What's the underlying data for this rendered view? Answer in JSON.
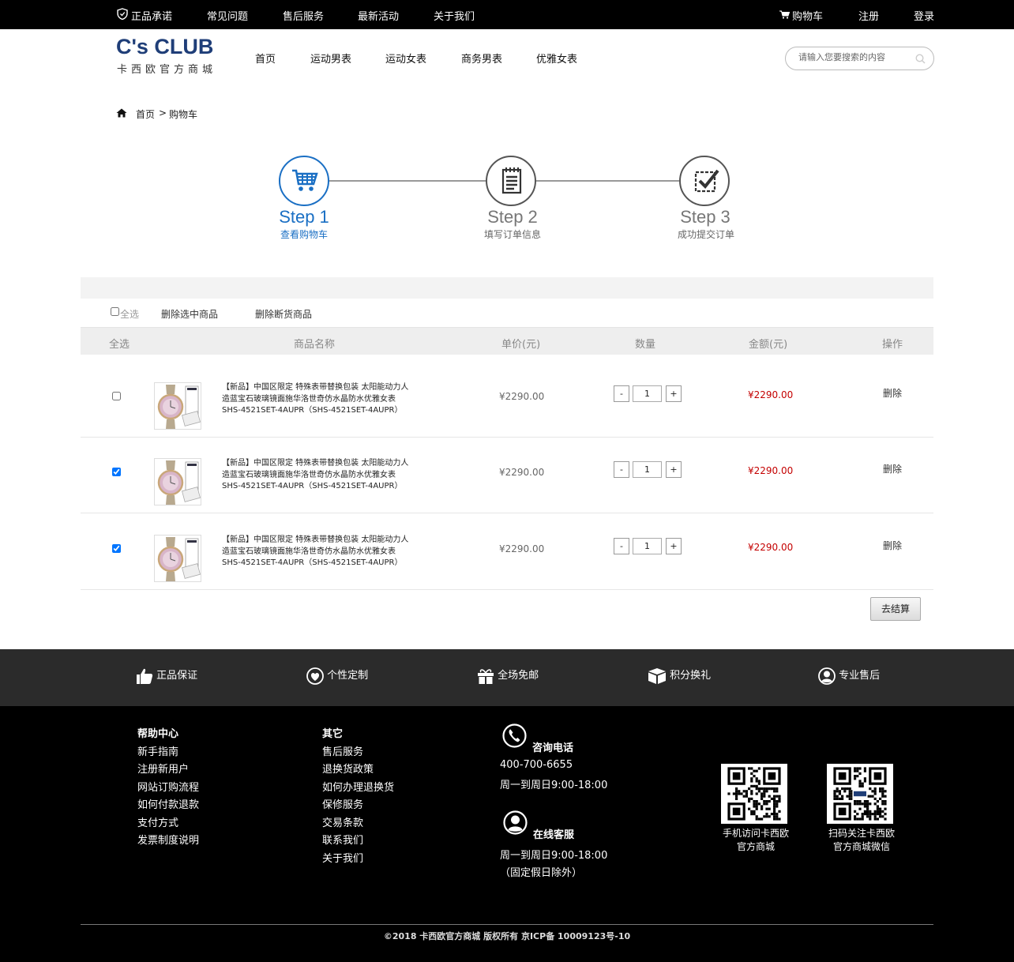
{
  "topbar": {
    "left": [
      "正品承诺",
      "常见问题",
      "售后服务",
      "最新活动",
      "关于我们"
    ],
    "cart": "购物车",
    "register": "注册",
    "login": "登录"
  },
  "header": {
    "logo": "C's CLUB",
    "logo_sub": "卡西欧官方商城",
    "nav": [
      "首页",
      "运动男表",
      "运动女表",
      "商务男表",
      "优雅女表"
    ],
    "search_placeholder": "请输入您要搜索的内容"
  },
  "breadcrumb": {
    "home": "首页",
    "sep": ">",
    "current": "购物车"
  },
  "steps": [
    {
      "title": "Step 1",
      "sub": "查看购物车",
      "active": true
    },
    {
      "title": "Step 2",
      "sub": "填写订单信息",
      "active": false
    },
    {
      "title": "Step 3",
      "sub": "成功提交订单",
      "active": false
    }
  ],
  "toolbar": {
    "select_all": "全选",
    "delete_selected": "删除选中商品",
    "delete_out_of_stock": "删除断货商品"
  },
  "table": {
    "headers": [
      "全选",
      "商品名称",
      "单价(元)",
      "数量",
      "金额(元)",
      "操作"
    ],
    "rows": [
      {
        "checked": false,
        "name": "【新品】中国区限定 特殊表带替换包装 太阳能动力人造蓝宝石玻璃镜面施华洛世奇仿水晶防水优雅女表SHS-4521SET-4AUPR（SHS-4521SET-4AUPR）",
        "price": "¥2290.00",
        "qty": "1",
        "amount": "¥2290.00",
        "action": "删除"
      },
      {
        "checked": true,
        "name": "【新品】中国区限定 特殊表带替换包装 太阳能动力人造蓝宝石玻璃镜面施华洛世奇仿水晶防水优雅女表SHS-4521SET-4AUPR（SHS-4521SET-4AUPR）",
        "price": "¥2290.00",
        "qty": "1",
        "amount": "¥2290.00",
        "action": "删除"
      },
      {
        "checked": true,
        "name": "【新品】中国区限定 特殊表带替换包装 太阳能动力人造蓝宝石玻璃镜面施华洛世奇仿水晶防水优雅女表SHS-4521SET-4AUPR（SHS-4521SET-4AUPR）",
        "price": "¥2290.00",
        "qty": "1",
        "amount": "¥2290.00",
        "action": "删除"
      }
    ],
    "minus": "-",
    "plus": "+"
  },
  "checkout": "去结算",
  "features": [
    "正品保证",
    "个性定制",
    "全场免邮",
    "积分换礼",
    "专业售后"
  ],
  "footer": {
    "help_title": "帮助中心",
    "help_links": [
      "新手指南",
      "注册新用户",
      "网站订购流程",
      "如何付款退款",
      "支付方式",
      "发票制度说明"
    ],
    "other_title": "其它",
    "other_links": [
      "售后服务",
      "退换货政策",
      "如何办理退换货",
      "保修服务",
      "交易条款",
      "联系我们",
      "关于我们"
    ],
    "phone_title": "咨询电话",
    "phone": "400-700-6655",
    "phone_hours": "周一到周日9:00-18:00",
    "service_title": "在线客服",
    "service_hours": "周一到周日9:00-18:00",
    "service_note": "（固定假日除外）",
    "qr1_caption": [
      "手机访问卡西欧",
      "官方商城"
    ],
    "qr2_caption": [
      "扫码关注卡西欧",
      "官方商城微信"
    ],
    "copyright": "©2018 卡西欧官方商城 版权所有 京ICP备 10009123号-10"
  },
  "colors": {
    "brand": "#1f3e78",
    "step_active": "#1a6fc4",
    "price_red": "#c40000",
    "footer_bar": "#2b2b2b"
  }
}
